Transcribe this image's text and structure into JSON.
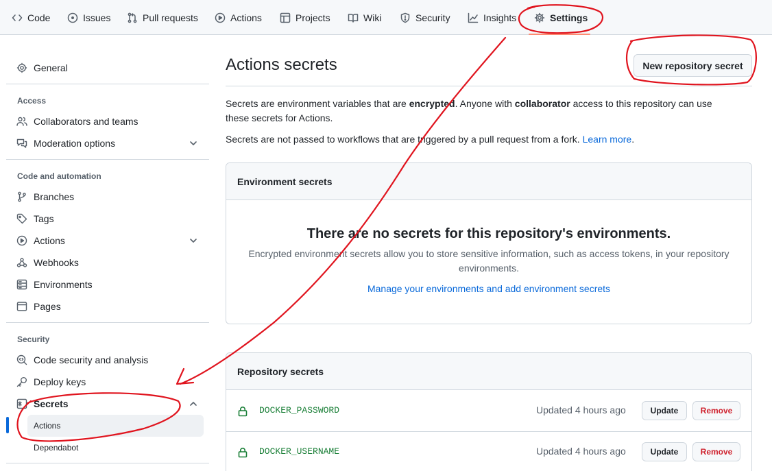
{
  "topnav": {
    "tabs": [
      {
        "label": "Code",
        "icon": "code-icon"
      },
      {
        "label": "Issues",
        "icon": "issue-opened-icon"
      },
      {
        "label": "Pull requests",
        "icon": "git-pull-request-icon"
      },
      {
        "label": "Actions",
        "icon": "play-icon"
      },
      {
        "label": "Projects",
        "icon": "table-icon"
      },
      {
        "label": "Wiki",
        "icon": "book-icon"
      },
      {
        "label": "Security",
        "icon": "shield-icon"
      },
      {
        "label": "Insights",
        "icon": "graph-icon"
      },
      {
        "label": "Settings",
        "icon": "gear-icon",
        "active": true
      }
    ],
    "active_underline_color": "#fd8c73"
  },
  "sidebar": {
    "general": "General",
    "sections": [
      {
        "heading": "Access",
        "items": [
          "Collaborators and teams",
          "Moderation options"
        ]
      },
      {
        "heading": "Code and automation",
        "items": [
          "Branches",
          "Tags",
          "Actions",
          "Webhooks",
          "Environments",
          "Pages"
        ]
      },
      {
        "heading": "Security",
        "items": [
          "Code security and analysis",
          "Deploy keys",
          "Secrets"
        ]
      }
    ],
    "secrets_subitems": [
      "Actions",
      "Dependabot"
    ],
    "selected": "Actions",
    "selected_indicator_color": "#0969da"
  },
  "main": {
    "title": "Actions secrets",
    "new_secret_button": "New repository secret",
    "description": {
      "p1_part1": "Secrets are environment variables that are ",
      "p1_bold1": "encrypted",
      "p1_part2": ". Anyone with ",
      "p1_bold2": "collaborator",
      "p1_part3": " access to this repository can use these secrets for Actions.",
      "p2_text": "Secrets are not passed to workflows that are triggered by a pull request from a fork. ",
      "p2_link": "Learn more",
      "p2_end": "."
    },
    "environment_secrets": {
      "header": "Environment secrets",
      "blank_title": "There are no secrets for this repository's environments.",
      "blank_text": "Encrypted environment secrets allow you to store sensitive information, such as access tokens, in your repository environments.",
      "blank_link": "Manage your environments and add environment secrets"
    },
    "repository_secrets": {
      "header": "Repository secrets",
      "rows": [
        {
          "name": "DOCKER_PASSWORD",
          "updated": "Updated 4 hours ago",
          "update": "Update",
          "remove": "Remove"
        },
        {
          "name": "DOCKER_USERNAME",
          "updated": "Updated 4 hours ago",
          "update": "Update",
          "remove": "Remove"
        }
      ]
    }
  },
  "annotation_color": "#e0141e"
}
